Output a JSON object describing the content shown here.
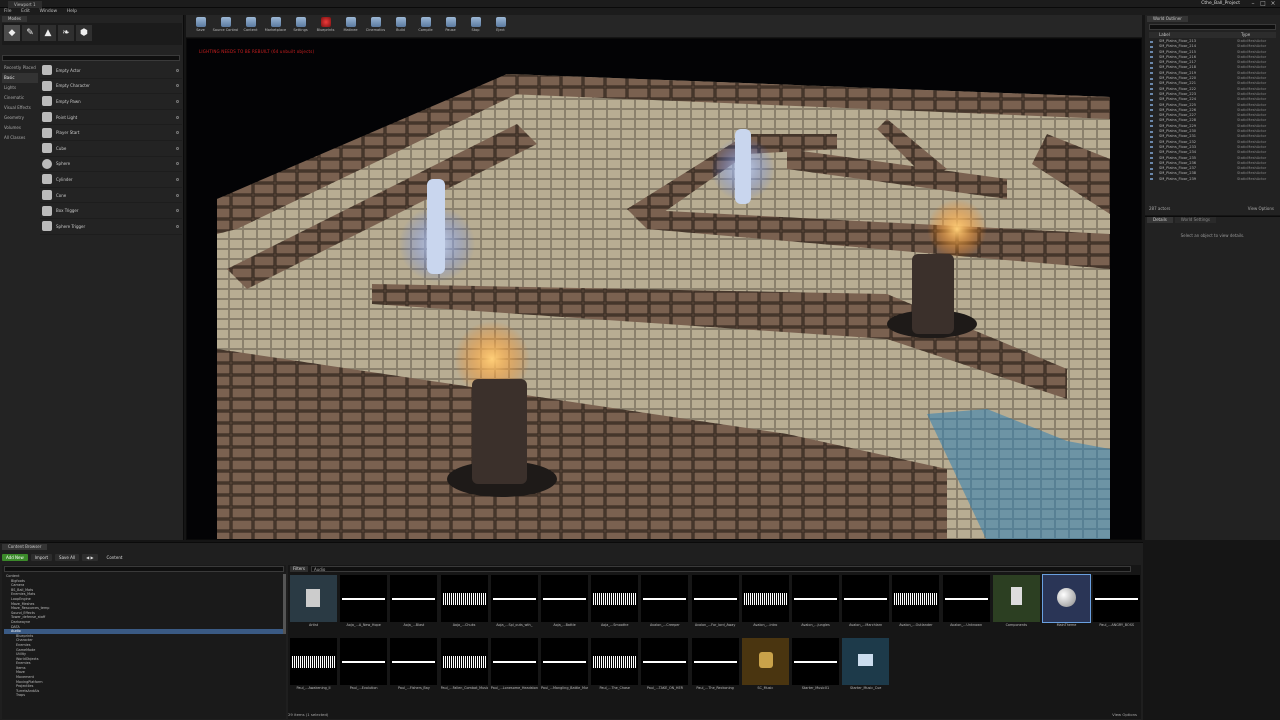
{
  "window": {
    "tab": "Viewport 1",
    "project": "Cthe_Ball_Project"
  },
  "menu": [
    "File",
    "Edit",
    "Window",
    "Help"
  ],
  "modes": {
    "tab": "Modes",
    "categories": [
      "Recently Placed",
      "Basic",
      "Lights",
      "Cinematic",
      "Visual Effects",
      "Geometry",
      "Volumes",
      "All Classes"
    ],
    "active_category": "Basic",
    "items": [
      "Empty Actor",
      "Empty Character",
      "Empty Pawn",
      "Point Light",
      "Player Start",
      "Cube",
      "Sphere",
      "Cylinder",
      "Cone",
      "Box Trigger",
      "Sphere Trigger"
    ]
  },
  "toolbar": [
    "Save",
    "Source Control",
    "Content",
    "Marketplace",
    "Settings",
    "Blueprints",
    "Matinee",
    "Cinematics",
    "Build",
    "Compile",
    "Pause",
    "Stop",
    "Eject"
  ],
  "viewport": {
    "message": "LIGHTING NEEDS TO BE REBUILT (64 unbuilt objects)"
  },
  "outliner": {
    "tab": "World Outliner",
    "col_label": "Label",
    "col_type": "Type",
    "type_value": "StaticMeshActor",
    "rows": [
      "SM_Plains_Floor_213",
      "SM_Plains_Floor_214",
      "SM_Plains_Floor_215",
      "SM_Plains_Floor_216",
      "SM_Plains_Floor_217",
      "SM_Plains_Floor_218",
      "SM_Plains_Floor_219",
      "SM_Plains_Floor_220",
      "SM_Plains_Floor_221",
      "SM_Plains_Floor_222",
      "SM_Plains_Floor_223",
      "SM_Plains_Floor_224",
      "SM_Plains_Floor_225",
      "SM_Plains_Floor_226",
      "SM_Plains_Floor_227",
      "SM_Plains_Floor_228",
      "SM_Plains_Floor_229",
      "SM_Plains_Floor_230",
      "SM_Plains_Floor_231",
      "SM_Plains_Floor_232",
      "SM_Plains_Floor_233",
      "SM_Plains_Floor_234",
      "SM_Plains_Floor_235",
      "SM_Plains_Floor_236",
      "SM_Plains_Floor_237",
      "SM_Plains_Floor_238",
      "SM_Plains_Floor_239"
    ],
    "count": "287 actors",
    "view_options": "View Options"
  },
  "details": {
    "tab": "Details",
    "tab2": "World Settings",
    "message": "Select an object to view details."
  },
  "content_browser": {
    "tab": "Content Browser",
    "add_new": "Add New",
    "import": "Import",
    "save_all": "Save All",
    "crumb": "Content",
    "tree": [
      "Content",
      "Bigfoots",
      "Camera",
      "BS_Ball_Mats",
      "Enemies_Mats",
      "LoopEngine",
      "Maze_Meshes",
      "Maze_Resources_temp",
      "Sound_Effects",
      "Tower_defense_staff",
      "Darkwayne",
      "DATA",
      "Audio",
      "Blueprints",
      "Character",
      "Enemies",
      "GameMode",
      "Utility",
      "WorldObjects",
      "Enemies",
      "Items",
      "Maze",
      "Movement",
      "MovingPlatform",
      "Projectiles",
      "TurretsAndAIs",
      "Traps"
    ],
    "selected_folder": "Audio",
    "filters": "Filters",
    "search": "Audio",
    "assets_row1": [
      "Artist",
      "Aoja_...A_New_Hope",
      "Aoja_...Blast",
      "Aoja_...Chuks",
      "Aoja_...Spl_outs_wth_",
      "Aoja_...Battle",
      "Aoja_...Smoothe",
      "Avalon_...Creeper",
      "Avalon_...For_lord_Away",
      "Avalon_...intro",
      "Avalon_...Jungles",
      "Avalon_...Marchlarn",
      "Avalon_...Outlander",
      "Avalon_...Unknown",
      "Components",
      "MainTheme",
      "Paul_...ANGRY_BOSS"
    ],
    "assets_row2": [
      "Paul_...Awakening_II",
      "Paul_...Evolution",
      "Paul_...Fishers_Bay",
      "Paul_...Fallen_Combat_Music",
      "Paul_...Lonesome_Headstone",
      "Paul_...Mangling_Battle_Music",
      "Paul_...The_Chase",
      "Paul_...TAKE_ON_HER",
      "Paul_...The_Reckoning",
      "SC_Music",
      "Starter_Music01",
      "Starter_Music_Cue"
    ],
    "footer": "29 items (1 selected)",
    "view_options": "View Options"
  }
}
